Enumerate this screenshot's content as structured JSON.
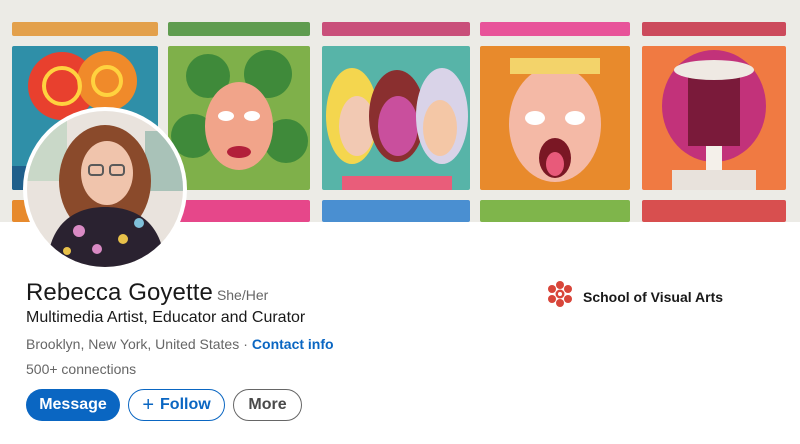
{
  "profile": {
    "name": "Rebecca Goyette",
    "pronouns": "She/Her",
    "headline": "Multimedia Artist, Educator and Curator",
    "location": "Brooklyn, New York, United States",
    "separator": "·",
    "contact_label": "Contact info",
    "connections": "500+ connections"
  },
  "school": {
    "name": "School of Visual Arts",
    "logo_icon": "sva-logo-icon",
    "logo_color": "#d8463a"
  },
  "actions": {
    "message_label": "Message",
    "follow_plus": "+",
    "follow_label": "Follow",
    "more_label": "More"
  },
  "colors": {
    "primary": "#0a66c2",
    "text": "#191919",
    "muted": "#666666"
  }
}
